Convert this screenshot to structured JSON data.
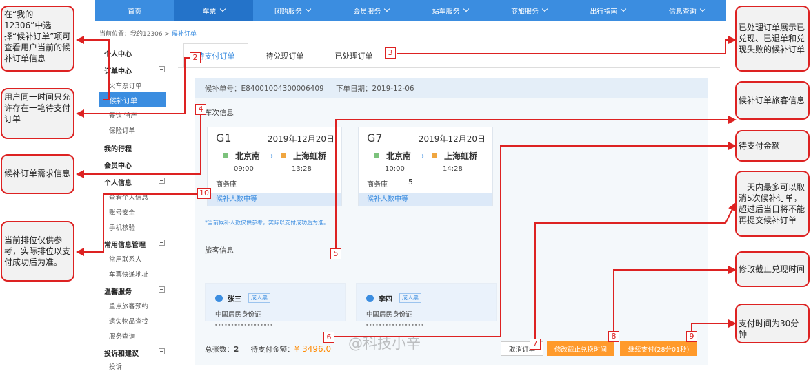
{
  "nav": {
    "items": [
      {
        "label": "首页",
        "has_caret": false
      },
      {
        "label": "车票",
        "has_caret": true
      },
      {
        "label": "团购服务",
        "has_caret": true
      },
      {
        "label": "会员服务",
        "has_caret": true
      },
      {
        "label": "站车服务",
        "has_caret": true
      },
      {
        "label": "商旅服务",
        "has_caret": true
      },
      {
        "label": "出行指南",
        "has_caret": true
      },
      {
        "label": "信息查询",
        "has_caret": true
      }
    ],
    "active_index": 1,
    "color": "#3b8de0"
  },
  "breadcrumb": {
    "prefix": "当前位置：我的12306 > ",
    "current": "候补订单"
  },
  "sidebar": {
    "personal_center": "个人中心",
    "order_center": "订单中心",
    "train_orders": "火车票订单",
    "waitlist_orders": "候补订单",
    "catering": "餐饮·特产",
    "insurance": "保险订单",
    "my_trips": "我的行程",
    "member_center": "会员中心",
    "personal_info": "个人信息",
    "view_personal_info": "查看个人信息",
    "account_security": "账号安全",
    "phone_verify": "手机核验",
    "common_info": "常用信息管理",
    "contacts": "常用联系人",
    "delivery_address": "车票快递地址",
    "warm_service": "温馨服务",
    "priority_booking": "重点旅客预约",
    "lost_items": "遗失物品查找",
    "service_query": "服务查询",
    "complaints": "投诉和建议",
    "complaints_sub": "投诉"
  },
  "tabs": [
    {
      "label": "待支付订单",
      "active": true
    },
    {
      "label": "待兑现订单",
      "active": false
    },
    {
      "label": "已处理订单",
      "active": false
    }
  ],
  "order": {
    "number_label": "候补单号：",
    "number": "E840010043000064​09",
    "date_label": "下单日期：",
    "date": "2019-12-06"
  },
  "trip_section_title": "车次信息",
  "trips": [
    {
      "train": "G1",
      "date": "2019年12月20日",
      "from": "北京南",
      "to": "上海虹桥",
      "depart": "09:00",
      "arrive": "13:28",
      "seat": "商务座",
      "queue": "候补人数中等"
    },
    {
      "train": "G7",
      "date": "2019年12月20日",
      "from": "北京南",
      "to": "上海虹桥",
      "depart": "10:00",
      "arrive": "14:28",
      "seat": "商务座",
      "queue": "候补人数中等"
    }
  ],
  "queue_note": "*当前候补人数仅供参考，实际以支付成功后为准。",
  "passenger_section_title": "旅客信息",
  "passengers": [
    {
      "name": "张三",
      "type": "成人票",
      "id_type": "中国居民身份证",
      "id_mask": "••••••••••••••••••"
    },
    {
      "name": "李四",
      "type": "成人票",
      "id_type": "中国居民身份证",
      "id_mask": "••••••••••••••••••"
    }
  ],
  "footer": {
    "count_label": "总张数：",
    "count": "2",
    "amount_label": "待支付金额：",
    "amount": "¥ 3496.0",
    "cancel_button": "取消订单",
    "modify_button": "修改截止兑换时间",
    "pay_button": "继续支付(28分01秒)"
  },
  "stray_mark": "5",
  "watermark": "@科技小辛",
  "callouts": {
    "c1": "在“我的12306”中选择“候补订单”项可查看用户当前的候补订单信息",
    "c2": "用户同一时间只允许存在一笔待支付订单",
    "c3": "候补订单需求信息",
    "c4": "当前排位仅供参考，实际排位以支付成功后为准。",
    "c5": "已处理订单展示已兑现、已退单和兑现失败的候补订单",
    "c6": "候补订单旅客信息",
    "c7": "待支付金额",
    "c8": "一天内最多可以取消5次候补订单，超过后当日将不能再提交候补订单",
    "c9": "修改截止兑现时间",
    "c10": "支付时间为30分钟"
  },
  "markers": [
    "2",
    "3",
    "4",
    "5",
    "6",
    "7",
    "8",
    "9",
    "10"
  ],
  "colors": {
    "accent": "#3b8de0",
    "callout_border": "#dd2222",
    "orange": "#ff9a2b",
    "amount": "#ff8a00"
  }
}
